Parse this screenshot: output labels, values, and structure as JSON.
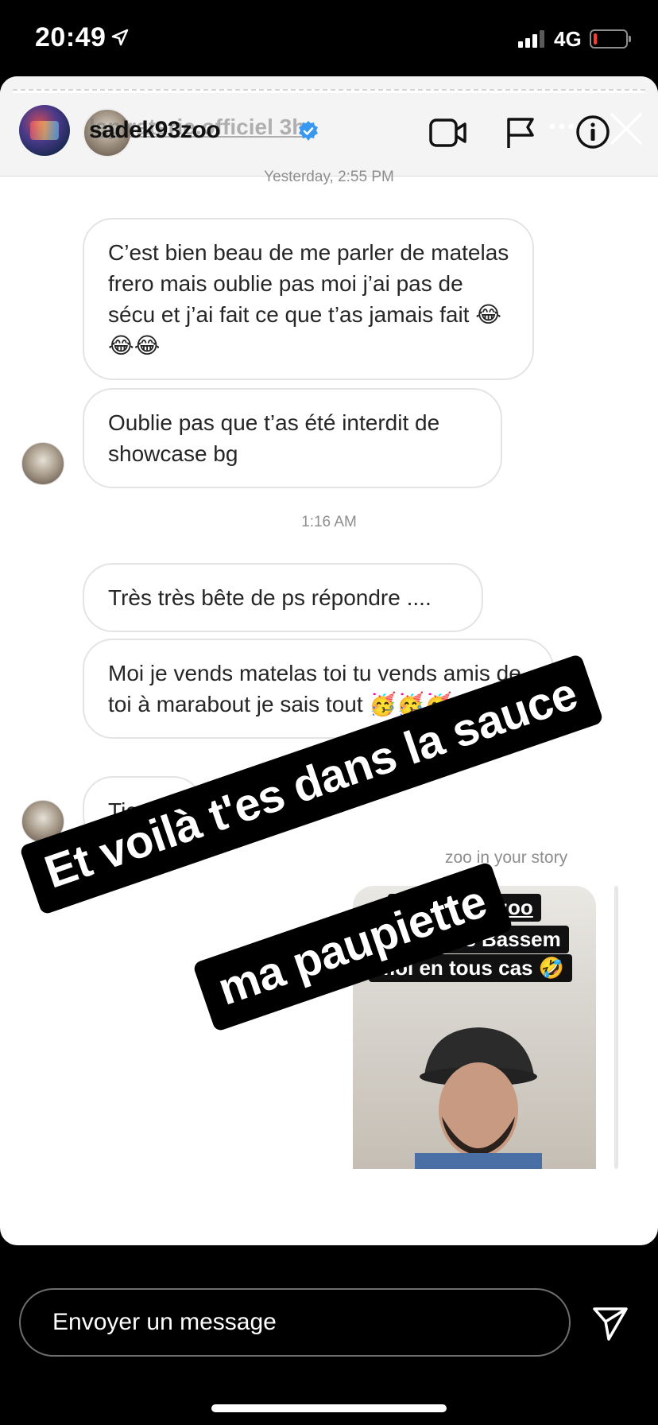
{
  "status_bar": {
    "time": "20:49",
    "network": "4G",
    "battery_color": "#ff3b30"
  },
  "story_header": {
    "account_ghost": "lapiraterie.officiel 3h",
    "username": "sadek93zoo",
    "icons": [
      "verified-badge-icon",
      "video-call-icon",
      "report-flag-icon",
      "more-icon",
      "info-icon",
      "close-icon"
    ]
  },
  "chat": {
    "timestamp_top": "Yesterday, 2:55 PM",
    "messages_group1": [
      "C’est bien beau de me parler de matelas frero mais oublie pas moi j’ai pas de sécu et j’ai fait ce que t’as jamais fait 😂😂😂",
      "Oublie pas que t’as été interdit de showcase bg"
    ],
    "timestamp_mid": "1:16 AM",
    "messages_group2": [
      "Très très bête de ps répondre ....",
      "Moi je vends matelas toi tu vends amis de toi à marabout je sais tout 🥳🥳🥳",
      "Tic tac"
    ],
    "story_reply_label": "zoo in your story",
    "story_tag_mention": "@sadek93zoo",
    "story_tag_line1": "J’suis pas Bassem",
    "story_tag_line2": "moi en tous cas 🤣"
  },
  "overlay": {
    "line1": "Et voilà t'es dans la sauce",
    "line2": "ma paupiette"
  },
  "footer": {
    "message_placeholder": "Envoyer un message"
  }
}
